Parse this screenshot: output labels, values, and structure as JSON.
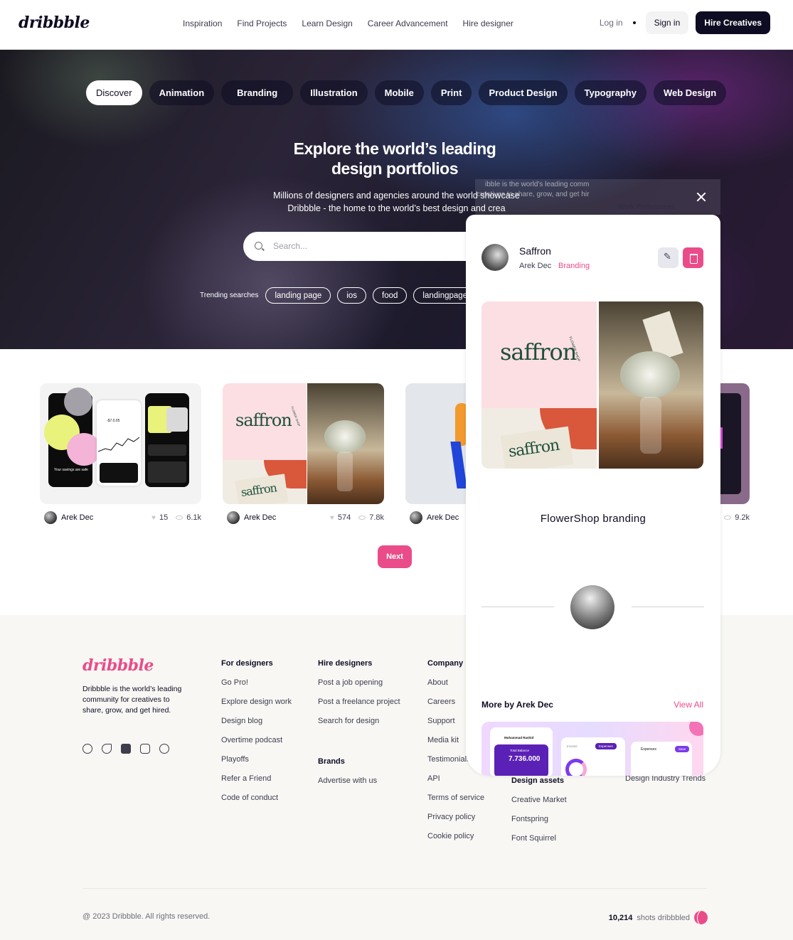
{
  "nav": {
    "logo": "dribbble",
    "links": [
      "Inspiration",
      "Find Projects",
      "Learn Design",
      "Career Advancement",
      "Hire designer"
    ],
    "login": "Log in",
    "signin": "Sign in",
    "hire": "Hire Creatives"
  },
  "hero": {
    "categories": [
      "Discover",
      "Animation",
      "Branding",
      "Illustration",
      "Mobile",
      "Print",
      "Product Design",
      "Typography",
      "Web Design"
    ],
    "title_line1": "Explore the world’s leading",
    "title_line2": "design portfolios",
    "sub_line1": "Millions of designers and agencies around the world showcase",
    "sub_line2": "Dribbble - the home to the world’s best design and crea",
    "search_placeholder": "Search...",
    "trending_label": "Trending searches",
    "trending": [
      "landing page",
      "ios",
      "food",
      "landingpage"
    ]
  },
  "shots": [
    {
      "author": "Arek Dec",
      "likes": "15",
      "views": "6.1k"
    },
    {
      "author": "Arek Dec",
      "likes": "574",
      "views": "7.8k"
    },
    {
      "author": "Arek Dec"
    },
    {
      "views": "9.2k"
    }
  ],
  "shot1": {
    "balance": "-$7.0.05",
    "caption": "Your savings are safe"
  },
  "brand_word": "saffron",
  "brand_ring": "FLOWER SHOP",
  "next": "Next",
  "modal": {
    "ghost_text_1": "ibble is the world's leading comm",
    "ghost_text_2": "creatives to share, grow, and get hir",
    "ghost_text_3": "Work Preferences",
    "title": "Saffron",
    "author": "Arek Dec",
    "category": "Branding",
    "shot_title": "FlowerShop branding",
    "more_by": "More by Arek Dec",
    "view_all": "View All",
    "thumb_name": "Muhammad Rashid",
    "thumb_balance_label": "Total Balance",
    "thumb_balance": "7.736.000",
    "thumb_tab1": "Income",
    "thumb_tab2": "Expenses",
    "thumb_expenses": "Expenses",
    "thumb_save": "Save"
  },
  "footer": {
    "logo": "dribbble",
    "desc": "Dribbble is the world’s leading community for creatives to share, grow, and get hired.",
    "for_designers": {
      "heading": "For designers",
      "items": [
        "Go Pro!",
        "Explore design work",
        "Design blog",
        "Overtime podcast",
        "Playoffs",
        "Refer a Friend",
        "Code of conduct"
      ]
    },
    "hire_designers": {
      "heading": "Hire designers",
      "items": [
        "Post a job opening",
        "Post a freelance project",
        "Search for design"
      ]
    },
    "brands": {
      "heading": "Brands",
      "items": [
        "Advertise with us"
      ]
    },
    "company": {
      "heading": "Company",
      "items": [
        "About",
        "Careers",
        "Support",
        "Media kit",
        "Testimonials",
        "API",
        "Terms of service",
        "Privacy policy",
        "Cookie policy"
      ]
    },
    "design_assets": {
      "heading": "Design assets",
      "items": [
        "Creative Market",
        "Fontspring",
        "Font Squirrel"
      ]
    },
    "industry_trends": "Design Industry Trends",
    "copyright": "@ 2023 Dribbble. All rights reserved.",
    "shots_count": "10,214",
    "shots_label": "shots dribbbled"
  }
}
